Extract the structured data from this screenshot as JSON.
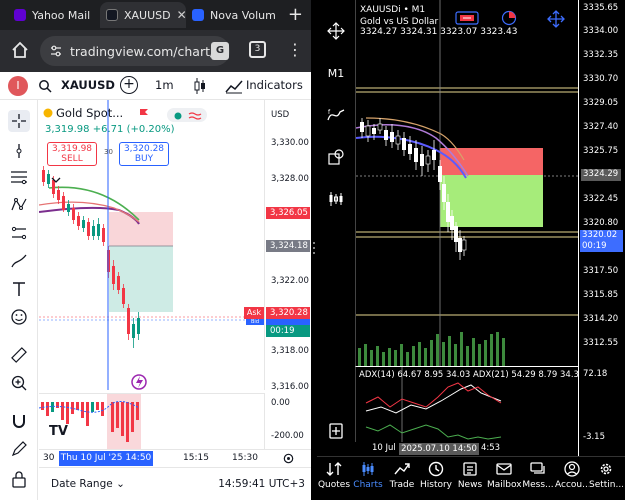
{
  "browser": {
    "tabs": [
      {
        "label": "Yahoo Mail",
        "favicon_color": "#6001d2"
      },
      {
        "label": "XAUUSD",
        "favicon_color": "#131722"
      },
      {
        "label": "Nova Volum",
        "favicon_color": "#2962ff"
      }
    ],
    "new_tab_label": "+",
    "url": "tradingview.com/chart/",
    "tab_count": "3",
    "translate_label": "G"
  },
  "tv": {
    "avatar_letter": "I",
    "symbol": "XAUUSD",
    "interval": "1m",
    "indicators_label": "Indicators",
    "legend": {
      "name": "Gold Spot...",
      "price": "3,319.98",
      "change": "+6.71",
      "change_pct": "(+0.20%)"
    },
    "sell": {
      "price": "3,319.98",
      "label": "SELL"
    },
    "buy": {
      "price": "3,320.28",
      "label": "BUY"
    },
    "spread": "30",
    "currency": "USD",
    "price_labels": [
      "3,330.00",
      "3,328.00",
      "3,324.00",
      "3,322.00",
      "3,318.00",
      "3,316.00"
    ],
    "tags": {
      "stop": "3,326.05",
      "entry": "3,324.18",
      "ask": "3,320.28",
      "ask_label": "Ask",
      "bid_label": "Bid",
      "countdown": "00:19"
    },
    "osc_labels": [
      "0.00",
      "-200.00"
    ],
    "logo": "TV",
    "time_labels": {
      "left": "30",
      "selected": "Thu 10 Jul '25",
      "selected_time": "14:50",
      "t1": "15:15",
      "t2": "15:30"
    },
    "date_range_label": "Date Range",
    "clock": "14:59:41 UTC+3",
    "colors": {
      "up": "#089981",
      "down": "#f23645",
      "accent": "#2962ff"
    }
  },
  "mt": {
    "symbol_line": "XAUUSDi • M1",
    "description": "Gold vs US Dollar",
    "ohlc": "3324.27 3324.31 3323.07 3323.43",
    "timeframe": "M1",
    "price_labels": [
      "3335.65",
      "3334.00",
      "3332.35",
      "3330.70",
      "3329.05",
      "3327.40",
      "3325.75",
      "3322.45",
      "3320.80",
      "3317.50",
      "3315.85",
      "3314.20",
      "3312.55"
    ],
    "tags": {
      "current": "3324.29",
      "bid": "3320.02",
      "countdown": "00:19"
    },
    "osc_labels": [
      "72.18",
      "-3.15"
    ],
    "adx_text": "ADX(14) 64.67 8.95 34.03 ADX(21) 54.29 8.79 34.30",
    "time_labels": {
      "left": "10 Jul",
      "selected": "2025.07.10 14:50",
      "right": "4:53"
    },
    "nav": [
      {
        "label": "Quotes",
        "icon": "quotes-icon"
      },
      {
        "label": "Charts",
        "icon": "charts-icon"
      },
      {
        "label": "Trade",
        "icon": "trade-icon"
      },
      {
        "label": "History",
        "icon": "history-icon"
      },
      {
        "label": "News",
        "icon": "news-icon"
      },
      {
        "label": "Mailbox",
        "icon": "mailbox-icon"
      },
      {
        "label": "Mess...",
        "icon": "messages-icon"
      },
      {
        "label": "Accou...",
        "icon": "account-icon"
      },
      {
        "label": "Settin...",
        "icon": "settings-icon"
      }
    ]
  }
}
